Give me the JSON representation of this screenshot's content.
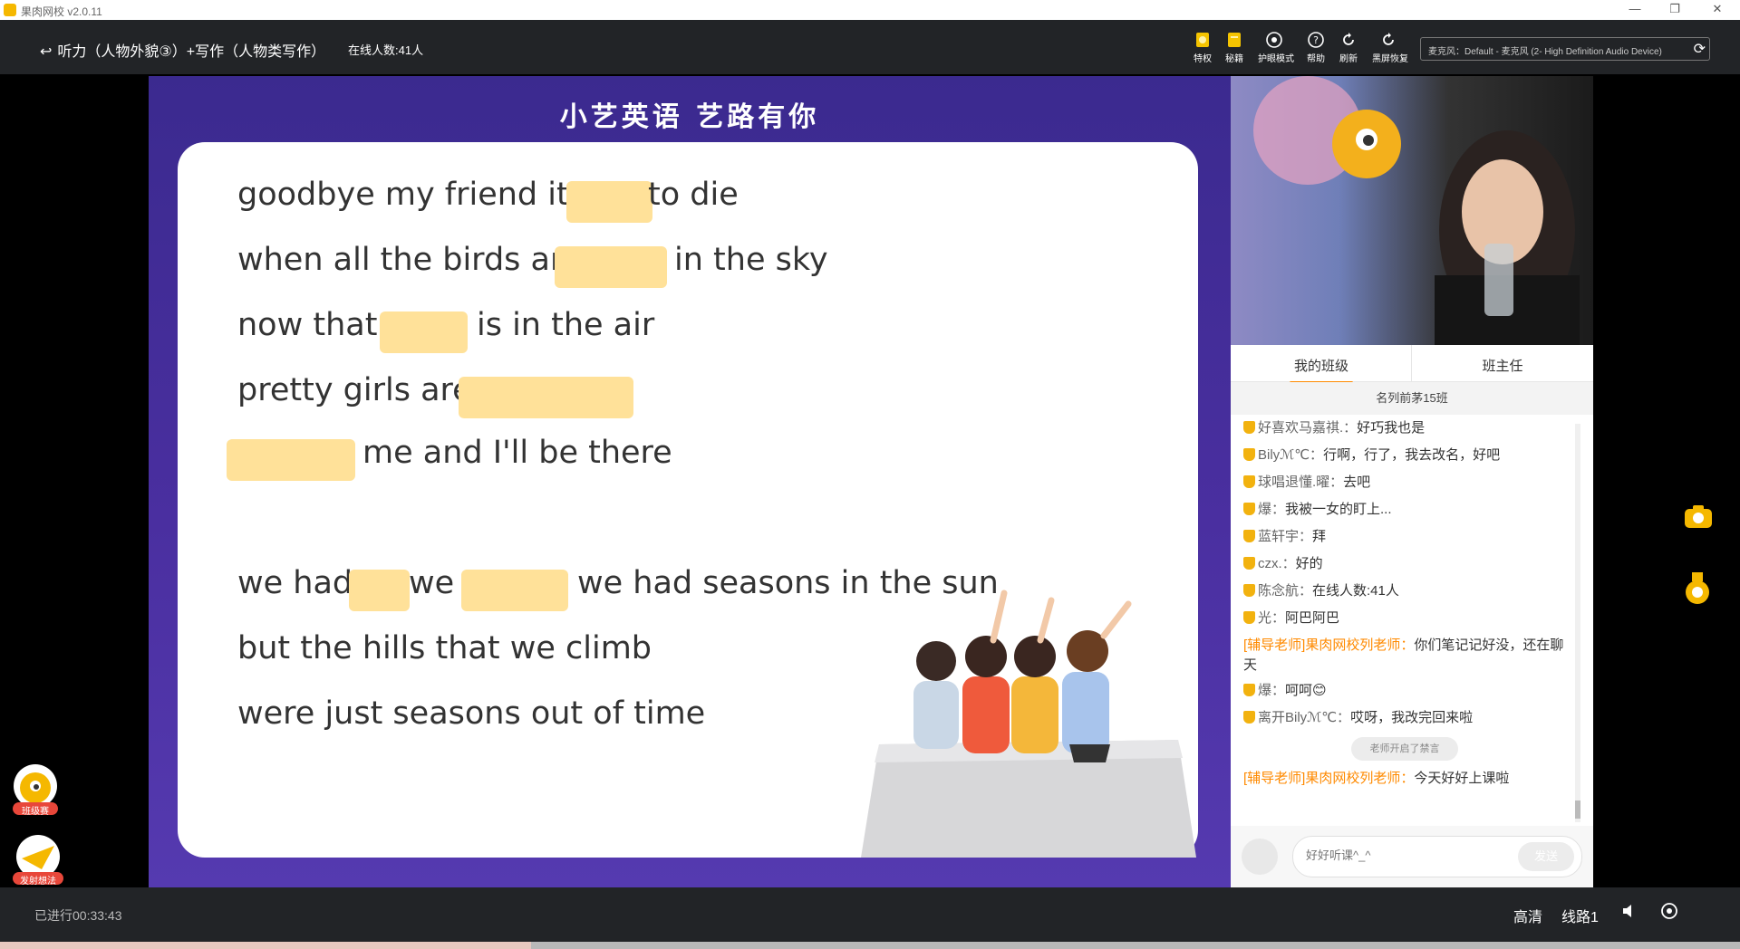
{
  "window": {
    "title": "果肉网校 v2.0.11",
    "minimize_icon": "minimize-icon",
    "maximize_icon": "maximize-icon",
    "close_icon": "close-icon"
  },
  "header": {
    "course_title": "听力（人物外貌③）+写作（人物类写作）",
    "online_count": "在线人数:41人",
    "tools": [
      {
        "label": "特权",
        "icon": "privilege-icon"
      },
      {
        "label": "秘籍",
        "icon": "secret-book-icon"
      },
      {
        "label": "护眼模式",
        "icon": "eye-care-icon"
      },
      {
        "label": "帮助",
        "icon": "help-icon"
      },
      {
        "label": "刷新",
        "icon": "refresh-icon"
      },
      {
        "label": "黑屏恢复",
        "icon": "black-screen-restore-icon"
      }
    ],
    "mic": "麦克风：Default - 麦克风 (2- High Definition Audio Device)"
  },
  "slide": {
    "title": "小艺英语  艺路有你",
    "lines": [
      {
        "text": "goodbye my friend it's",
        "text2": "to die"
      },
      {
        "text": "when all the birds are",
        "text2": "in the sky"
      },
      {
        "text": "now that",
        "text2": "is in the air"
      },
      {
        "text": "pretty girls are"
      },
      {
        "text": "me and I'll be there"
      },
      {
        "text": "we had",
        "text2": "we",
        "text3": "we had seasons in the sun"
      },
      {
        "text": "but the hills that we climb"
      },
      {
        "text": "were just seasons out of time"
      }
    ]
  },
  "side": {
    "tabs": [
      "我的班级",
      "班主任"
    ],
    "rank": "名列前茅15班",
    "messages": [
      {
        "nick": "好喜欢马嘉祺.：",
        "text": "好巧我也是"
      },
      {
        "nick": "Bilyℳ℃：",
        "text": "行啊，行了，我去改名，好吧"
      },
      {
        "nick": "球唱退懂.曜：",
        "text": "去吧"
      },
      {
        "nick": "爆：",
        "text": "我被一女的盯上..."
      },
      {
        "nick": "蓝轩宇：",
        "text": "拜"
      },
      {
        "nick": "czx.：",
        "text": "好的"
      },
      {
        "nick": "陈念航：",
        "text": "在线人数:41人"
      },
      {
        "nick": "光：",
        "text": "阿巴阿巴"
      },
      {
        "nick": "[辅导老师]果肉网校列老师：",
        "text": "你们笔记记好没，还在聊天"
      },
      {
        "nick": "爆：",
        "text": "呵呵😊"
      },
      {
        "nick": "离开Bilyℳ℃：",
        "text": "哎呀，我改完回来啦"
      },
      {
        "nick": "[辅导老师]果肉网校列老师：",
        "text": "今天好好上课啦"
      }
    ],
    "system_note": "老师开启了禁言",
    "input_placeholder": "好好听课^_^",
    "send_label": "发送"
  },
  "floating": {
    "class_race_label": "班级赛",
    "send_idea_label": "发射想法"
  },
  "bottom": {
    "elapsed": "已进行00:33:43",
    "quality": "高清",
    "route": "线路1"
  },
  "colors": {
    "slide_bg": "#4a2fa0",
    "blank": "#ffe199",
    "accent": "#ff8a00",
    "toolbar_bg": "#222427"
  },
  "playback": {
    "progress_fraction": 0.305
  }
}
